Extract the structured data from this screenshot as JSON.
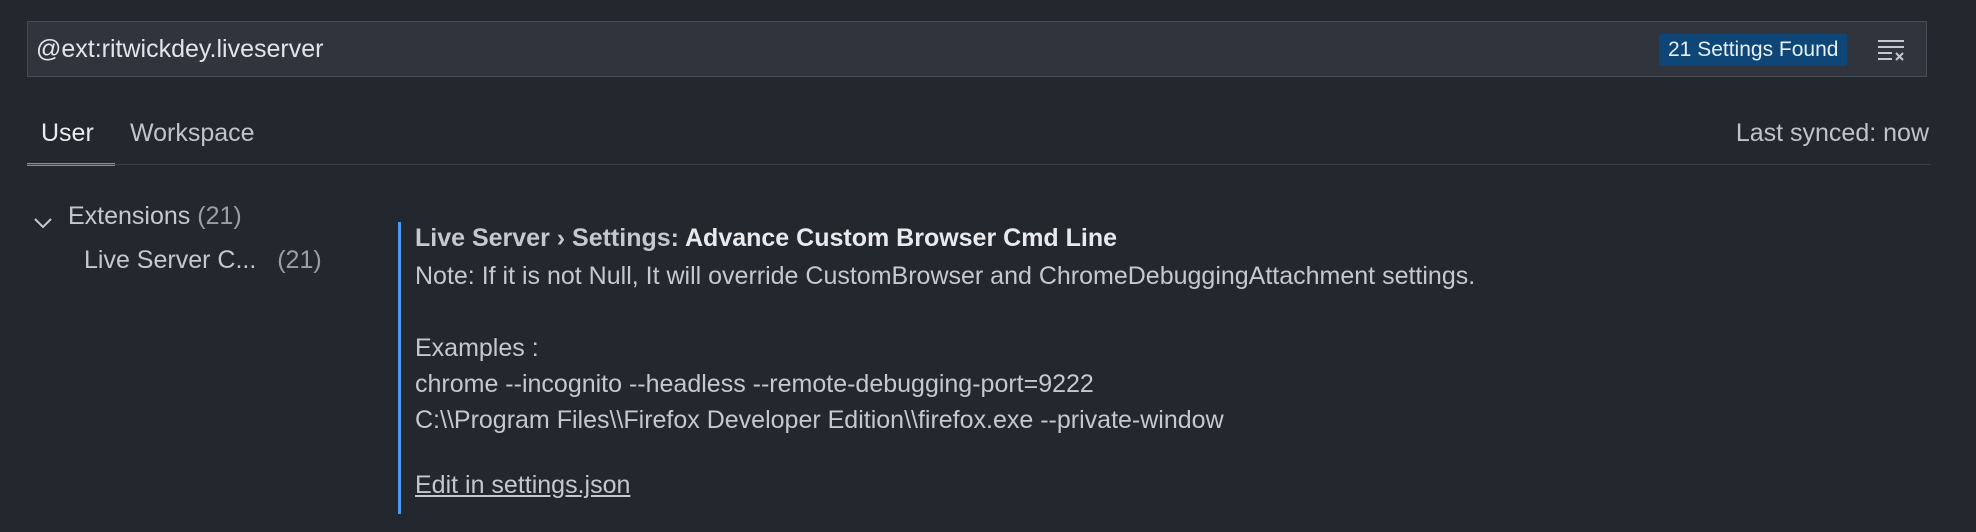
{
  "search": {
    "value": "@ext:ritwickdey.liveserver",
    "results_badge": "21 Settings Found"
  },
  "tabs": [
    {
      "label": "User",
      "active": true
    },
    {
      "label": "Workspace",
      "active": false
    }
  ],
  "sync_status": "Last synced: now",
  "toc": {
    "group": {
      "label": "Extensions",
      "count": "(21)"
    },
    "items": [
      {
        "label": "Live Server C...",
        "count": "(21)"
      }
    ]
  },
  "setting": {
    "category": "Live Server › Settings: ",
    "name": "Advance Custom Browser Cmd Line",
    "description": [
      "Note: If it is not Null, It will override CustomBrowser and ChromeDebuggingAttachment settings.",
      "Examples :",
      "chrome --incognito --headless --remote-debugging-port=9222",
      "C:\\\\Program Files\\\\Firefox Developer Edition\\\\firefox.exe --private-window"
    ],
    "edit_link": "Edit in settings.json"
  },
  "colors": {
    "background": "#23272e",
    "accent": "#4c9bf0",
    "badge": "#0e4678"
  },
  "icons": {
    "clear": "clear-filter-icon",
    "chevron": "chevron-down-icon"
  }
}
